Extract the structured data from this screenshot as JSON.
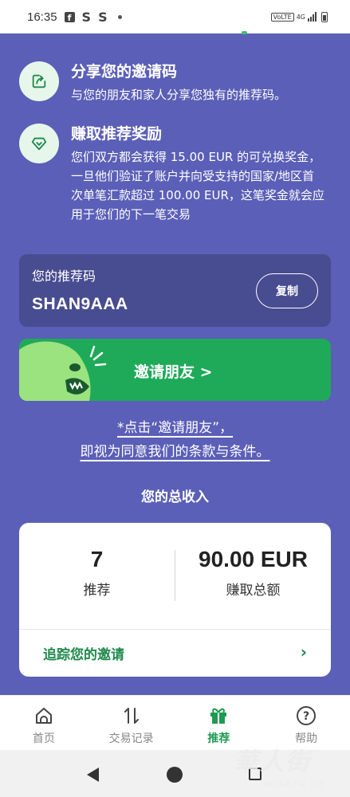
{
  "status_bar": {
    "time": "16:35",
    "notification_letters": [
      "S",
      "S"
    ],
    "volte": "VoLTE",
    "network": "4G"
  },
  "features": [
    {
      "icon": "share-icon",
      "title": "分享您的邀请码",
      "desc": "与您的朋友和家人分享您独有的推荐码。"
    },
    {
      "icon": "diamond-icon",
      "title": "赚取推荐奖励",
      "desc": "您们双方都会获得 15.00 EUR 的可兑换奖金，一旦他们验证了账户并向受支持的国家/地区首次单笔汇款超过 100.00 EUR，这笔奖金就会应用于您们的下一笔交易"
    }
  ],
  "referral": {
    "label": "您的推荐码",
    "code": "SHAN9AAA",
    "copy_label": "复制"
  },
  "invite": {
    "label": "邀请朋友 >"
  },
  "terms": {
    "line1": "*点击“邀请朋友”，",
    "line2": "即视为同意我们的条款与条件。"
  },
  "earnings": {
    "title": "您的总收入",
    "referrals_value": "7",
    "referrals_label": "推荐",
    "amount_value": "90.00 EUR",
    "amount_label": "赚取总额",
    "track_label": "追踪您的邀请"
  },
  "bottom_nav": [
    {
      "icon": "home-icon",
      "label": "首页",
      "active": false
    },
    {
      "icon": "transfer-history-icon",
      "label": "交易记录",
      "active": false
    },
    {
      "icon": "gift-icon",
      "label": "推荐",
      "active": true
    },
    {
      "icon": "help-icon",
      "label": "帮助",
      "active": false
    }
  ],
  "watermark": {
    "text": "華人街",
    "sub": "HUAREN.JIE"
  },
  "colors": {
    "background": "#5b5fb7",
    "card_dark": "#484c90",
    "invite_green": "#1faa59",
    "accent_green": "#1f8a4c"
  }
}
